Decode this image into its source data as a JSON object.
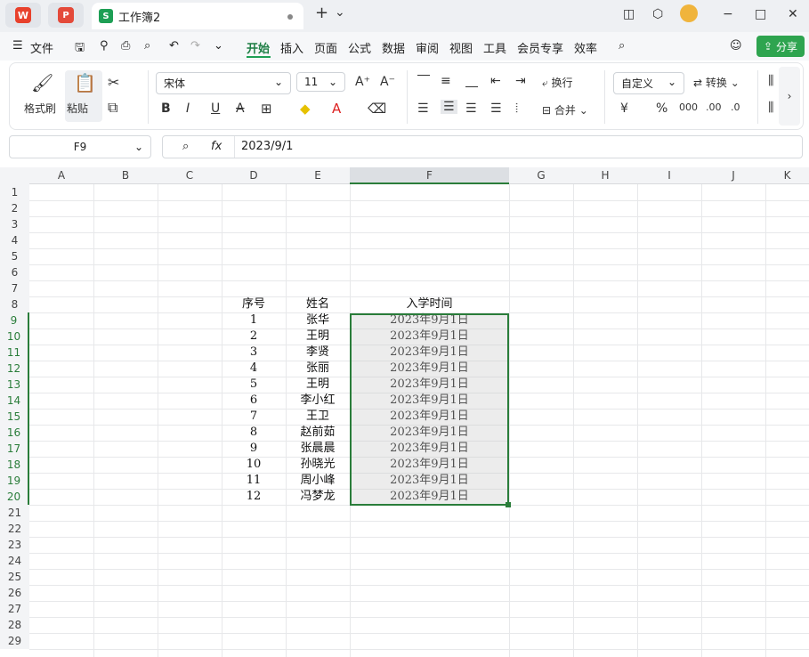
{
  "titlebar": {
    "wps_glyph": "W",
    "pdf_glyph": "P",
    "doc_icon_glyph": "S",
    "doc_title": "工作簿2",
    "new_tab_glyph": "+",
    "dropdown_glyph": "⌄",
    "window_controls": [
      "−",
      "□",
      "✕"
    ]
  },
  "menu": {
    "file_label": "文件",
    "tabs": [
      "开始",
      "插入",
      "页面",
      "公式",
      "数据",
      "审阅",
      "视图",
      "工具",
      "会员专享",
      "效率"
    ],
    "active_tab": "开始",
    "share_label": "分享"
  },
  "ribbon": {
    "format_painter": "格式刷",
    "paste": "粘贴",
    "font_name": "宋体",
    "font_size": "11",
    "wrap": "换行",
    "merge": "合并",
    "number_format": "自定义",
    "convert": "转换",
    "bold": "B",
    "italic": "I",
    "underline": "U",
    "strike": "A"
  },
  "formula_bar": {
    "name_box": "F9",
    "fx": "fx",
    "value": "2023/9/1"
  },
  "columns": [
    "A",
    "B",
    "C",
    "D",
    "E",
    "F",
    "G",
    "H",
    "I",
    "J",
    "K"
  ],
  "rows": [
    "1",
    "2",
    "3",
    "4",
    "5",
    "6",
    "7",
    "8",
    "9",
    "10",
    "11",
    "12",
    "13",
    "14",
    "15",
    "16",
    "17",
    "18",
    "19",
    "20",
    "21",
    "22",
    "23",
    "24",
    "25",
    "26",
    "27",
    "28",
    "29"
  ],
  "table": {
    "headers": [
      "序号",
      "姓名",
      "入学时间"
    ],
    "rows": [
      [
        "1",
        "张华",
        "2023年9月1日"
      ],
      [
        "2",
        "王明",
        "2023年9月1日"
      ],
      [
        "3",
        "李贤",
        "2023年9月1日"
      ],
      [
        "4",
        "张丽",
        "2023年9月1日"
      ],
      [
        "5",
        "王明",
        "2023年9月1日"
      ],
      [
        "6",
        "李小红",
        "2023年9月1日"
      ],
      [
        "7",
        "王卫",
        "2023年9月1日"
      ],
      [
        "8",
        "赵前茹",
        "2023年9月1日"
      ],
      [
        "9",
        "张晨晨",
        "2023年9月1日"
      ],
      [
        "10",
        "孙晓光",
        "2023年9月1日"
      ],
      [
        "11",
        "周小峰",
        "2023年9月1日"
      ],
      [
        "12",
        "冯梦龙",
        "2023年9月1日"
      ]
    ]
  },
  "colors": {
    "accent": "#1e9f55",
    "selection": "#2a7d3a"
  }
}
